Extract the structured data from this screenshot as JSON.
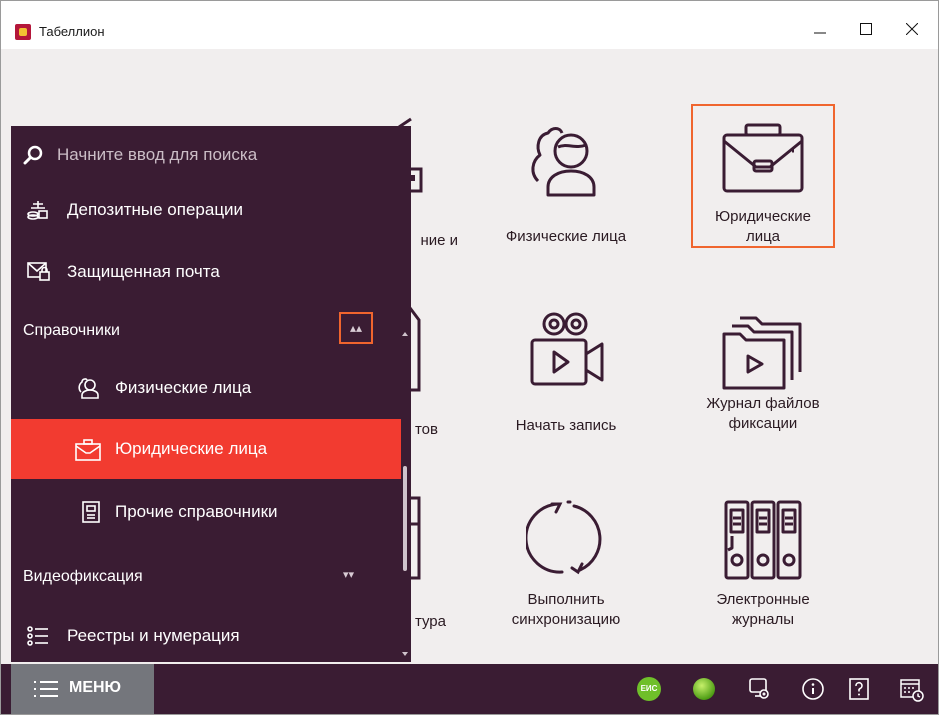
{
  "window": {
    "title": "Табеллион"
  },
  "tiles": {
    "natural_persons": "Физические лица",
    "legal_persons_line1": "Юридические",
    "legal_persons_line2": "лица",
    "start_recording": "Начать запись",
    "journal_line1": "Журнал файлов",
    "journal_line2": "фиксации",
    "sync_line1": "Выполнить",
    "sync_line2": "синхронизацию",
    "ejournals_line1": "Электронные",
    "ejournals_line2": "журналы",
    "partial_1": "ние и",
    "partial_2": "тов",
    "partial_3": "тура"
  },
  "sidebar": {
    "search_placeholder": "Начните ввод для поиска",
    "items": [
      {
        "label": "Депозитные операции",
        "icon": "deposit-icon"
      },
      {
        "label": "Защищенная почта",
        "icon": "secure-mail-icon"
      },
      {
        "label": "Справочники",
        "icon": "collapse-chevrons-icon",
        "expanded": true
      },
      {
        "label": "Физические лица",
        "icon": "person-icon"
      },
      {
        "label": "Юридические лица",
        "icon": "briefcase-icon",
        "active": true
      },
      {
        "label": "Прочие справочники",
        "icon": "document-icon"
      },
      {
        "label": "Видеофиксация",
        "icon": "expand-chevrons-icon",
        "expanded": false
      },
      {
        "label": "Реестры и нумерация",
        "icon": "list-icon"
      }
    ]
  },
  "bottombar": {
    "menu_label": "МЕНЮ",
    "eis_badge": "ЕИС"
  },
  "colors": {
    "sidebar_bg": "#3a1c33",
    "active_item": "#f23b30",
    "highlight_border": "#f0652e",
    "content_bg": "#f1eeee",
    "icon_stroke": "#3a1c33",
    "status_green": "#6fbf2a"
  }
}
